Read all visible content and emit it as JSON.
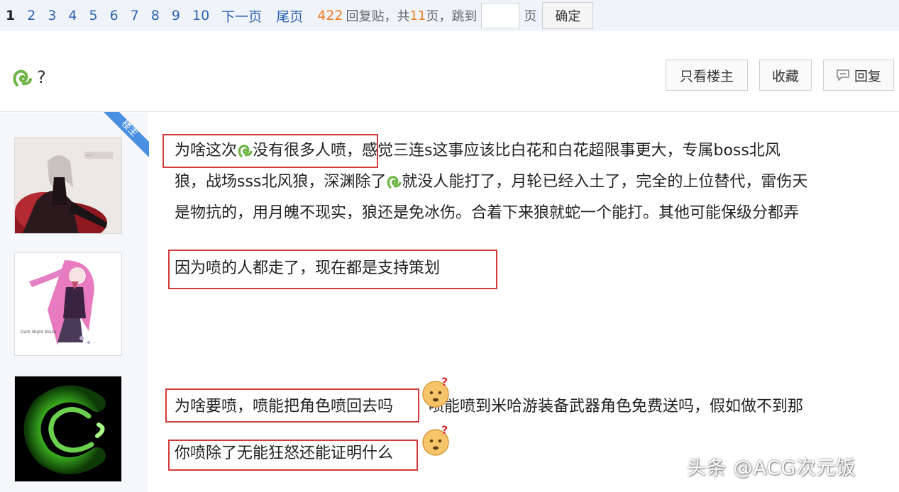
{
  "pager": {
    "pages": [
      "1",
      "2",
      "3",
      "4",
      "5",
      "6",
      "7",
      "8",
      "9",
      "10"
    ],
    "current": "1",
    "next_label": "下一页",
    "last_label": "尾页",
    "reply_count": "422",
    "reply_label": "回复贴，共",
    "page_count": "11",
    "page_suffix": "页，跳到",
    "jump_suffix": "页",
    "jump_value": "",
    "confirm_label": "确定"
  },
  "thread": {
    "title_suffix": "?",
    "btn_op_only": "只看楼主",
    "btn_favorite": "收藏",
    "btn_reply": "回复"
  },
  "lz_badge": "楼主",
  "posts": {
    "p1_line1_a": "为啥这次",
    "p1_line1_b": "没有很多人喷",
    "p1_line1_c": "，感觉三连s这事应该比白花和白花超限事更大，专属boss北风",
    "p1_line2_a": "狼，战场sss北风狼，深渊除了",
    "p1_line2_b": "就没人能打了，月轮已经入土了，完全的上位替代，雷伤天",
    "p1_line3": "是物抗的，用月魄不现实，狼还是免冰伤。合着下来狼就蛇一个能打。其他可能保级分都弄",
    "p2": "因为喷的人都走了，现在都是支持策划",
    "p3_line1_a": "为啥要喷，喷能把角色喷回去吗",
    "p3_line1_b": "喷能喷到米哈游装备武器角色免费送吗，假如做不到那",
    "p3_line2": "你喷除了无能狂怒还能证明什么"
  },
  "avatars": {
    "av2_caption": "Dark Night Blaze"
  },
  "watermark": "头条 @ACG次元饭",
  "colors": {
    "link": "#2d64b3",
    "accent": "#f07b1d",
    "highlight_box": "#d33a3a",
    "lz_badge": "#4a90e2"
  }
}
